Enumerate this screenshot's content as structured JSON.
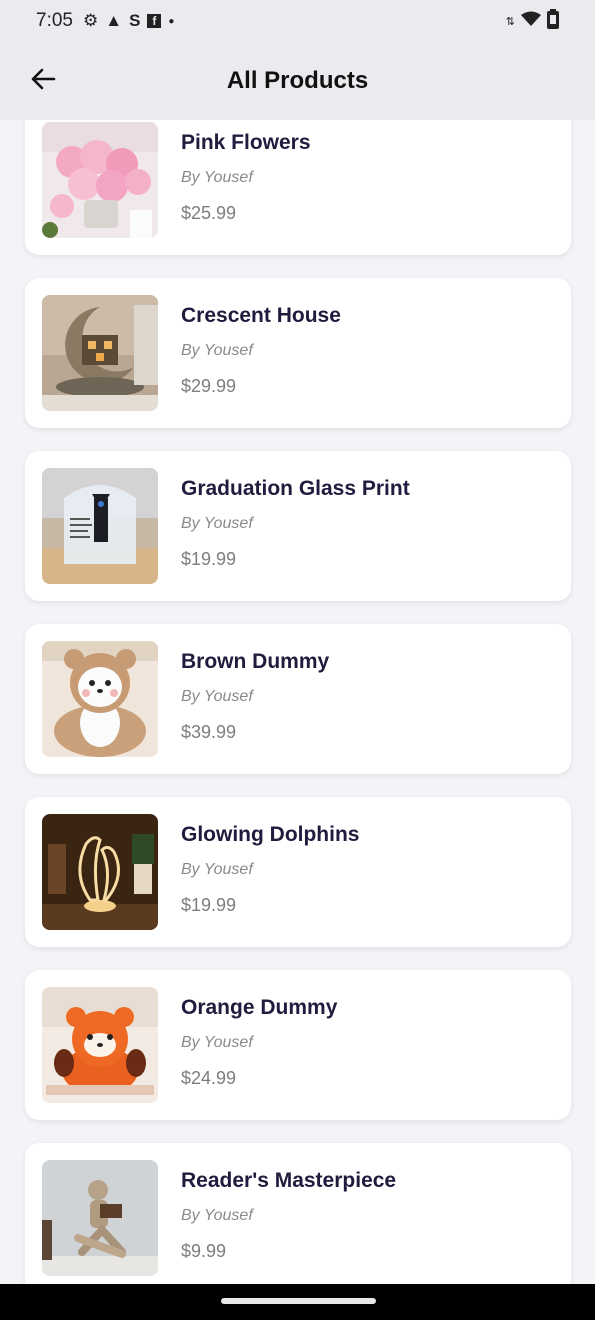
{
  "status_bar": {
    "time": "7:05",
    "icons": [
      "settings-icon",
      "alert-icon",
      "s-app-icon",
      "facebook-icon",
      "dot-icon"
    ],
    "right_icons": [
      "data-arrows-icon",
      "wifi-icon",
      "battery-icon"
    ]
  },
  "app_bar": {
    "title": "All Products",
    "back_icon": "arrow-left-icon"
  },
  "products": [
    {
      "name": "Pink Flowers",
      "author": "By Yousef",
      "price": "$25.99"
    },
    {
      "name": "Crescent House",
      "author": "By Yousef",
      "price": "$29.99"
    },
    {
      "name": "Graduation Glass Print",
      "author": "By Yousef",
      "price": "$19.99"
    },
    {
      "name": "Brown Dummy",
      "author": "By Yousef",
      "price": "$39.99"
    },
    {
      "name": "Glowing Dolphins",
      "author": "By Yousef",
      "price": "$19.99"
    },
    {
      "name": "Orange Dummy",
      "author": "By Yousef",
      "price": "$24.99"
    },
    {
      "name": "Reader's Masterpiece",
      "author": "By Yousef",
      "price": "$9.99"
    }
  ],
  "colors": {
    "background": "#f4f4f8",
    "card": "#ffffff",
    "title_text": "#1f1c3d",
    "meta_text": "#8a8a8e"
  }
}
